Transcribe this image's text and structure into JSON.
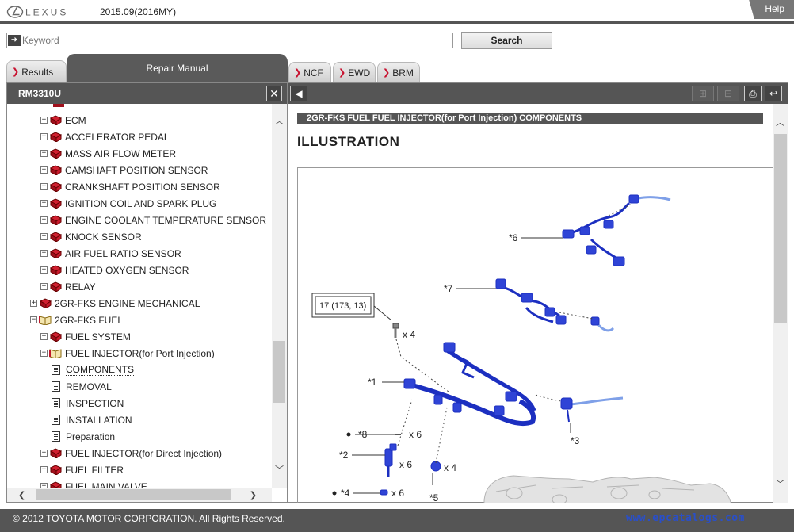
{
  "header": {
    "logo_text": "LEXUS",
    "model_date": "2015.09(2016MY)",
    "help_label": "Help"
  },
  "search": {
    "placeholder": "Keyword",
    "button_label": "Search"
  },
  "tabs": {
    "results": "Results",
    "repair_manual": "Repair Manual",
    "ncf": "NCF",
    "ewd": "EWD",
    "brm": "BRM"
  },
  "left_panel": {
    "title": "RM3310U",
    "close_label": "✕",
    "tree": [
      {
        "label": "ECM",
        "level": 2,
        "icon": "book-closed-icon",
        "toggle": "+"
      },
      {
        "label": "ACCELERATOR PEDAL",
        "level": 2,
        "icon": "book-closed-icon",
        "toggle": "+"
      },
      {
        "label": "MASS AIR FLOW METER",
        "level": 2,
        "icon": "book-closed-icon",
        "toggle": "+"
      },
      {
        "label": "CAMSHAFT POSITION SENSOR",
        "level": 2,
        "icon": "book-closed-icon",
        "toggle": "+"
      },
      {
        "label": "CRANKSHAFT POSITION SENSOR",
        "level": 2,
        "icon": "book-closed-icon",
        "toggle": "+"
      },
      {
        "label": "IGNITION COIL AND SPARK PLUG",
        "level": 2,
        "icon": "book-closed-icon",
        "toggle": "+"
      },
      {
        "label": "ENGINE COOLANT TEMPERATURE SENSOR",
        "level": 2,
        "icon": "book-closed-icon",
        "toggle": "+"
      },
      {
        "label": "KNOCK SENSOR",
        "level": 2,
        "icon": "book-closed-icon",
        "toggle": "+"
      },
      {
        "label": "AIR FUEL RATIO SENSOR",
        "level": 2,
        "icon": "book-closed-icon",
        "toggle": "+"
      },
      {
        "label": "HEATED OXYGEN SENSOR",
        "level": 2,
        "icon": "book-closed-icon",
        "toggle": "+"
      },
      {
        "label": "RELAY",
        "level": 2,
        "icon": "book-closed-icon",
        "toggle": "+"
      },
      {
        "label": "2GR-FKS ENGINE MECHANICAL",
        "level": 1,
        "icon": "book-closed-icon",
        "toggle": "+"
      },
      {
        "label": "2GR-FKS FUEL",
        "level": 1,
        "icon": "book-open-icon",
        "toggle": "-"
      },
      {
        "label": "FUEL SYSTEM",
        "level": 2,
        "icon": "book-closed-icon",
        "toggle": "+"
      },
      {
        "label": "FUEL INJECTOR(for Port Injection)",
        "level": 2,
        "icon": "book-open-icon",
        "toggle": "-"
      },
      {
        "label": "COMPONENTS",
        "level": 3,
        "icon": "document-icon",
        "toggle": "",
        "selected": true
      },
      {
        "label": "REMOVAL",
        "level": 3,
        "icon": "document-icon",
        "toggle": ""
      },
      {
        "label": "INSPECTION",
        "level": 3,
        "icon": "document-icon",
        "toggle": ""
      },
      {
        "label": "INSTALLATION",
        "level": 3,
        "icon": "document-icon",
        "toggle": ""
      },
      {
        "label": "Preparation",
        "level": 3,
        "icon": "document-icon",
        "toggle": ""
      },
      {
        "label": "FUEL INJECTOR(for Direct Injection)",
        "level": 2,
        "icon": "book-closed-icon",
        "toggle": "+"
      },
      {
        "label": "FUEL FILTER",
        "level": 2,
        "icon": "book-closed-icon",
        "toggle": "+"
      },
      {
        "label": "FUEL MAIN VALVE",
        "level": 2,
        "icon": "book-closed-icon",
        "toggle": "+"
      }
    ]
  },
  "content": {
    "section_title": "2GR-FKS FUEL  FUEL INJECTOR(for Port Injection)  COMPONENTS",
    "heading": "ILLUSTRATION",
    "torque_spec": "17 (173, 13)",
    "callouts": {
      "c6": "*6",
      "c7": "*7",
      "c1": "*1",
      "c3": "*3",
      "c8": "*8",
      "c2": "*2",
      "c4": "*4",
      "c5": "*5",
      "q_bolt": "x 4",
      "q_8": "x 6",
      "q_2": "x 6",
      "q_5": "x 4",
      "q_4": "x 6"
    }
  },
  "footer": {
    "copyright": "© 2012 TOYOTA MOTOR CORPORATION. All Rights Reserved.",
    "watermark": "www.epcatalogs.com"
  },
  "colors": {
    "toolbar_dark": "#555555",
    "tab_arrow": "#c8102e",
    "part_blue": "#1c2fc0",
    "watermark": "#2a4fc8"
  }
}
